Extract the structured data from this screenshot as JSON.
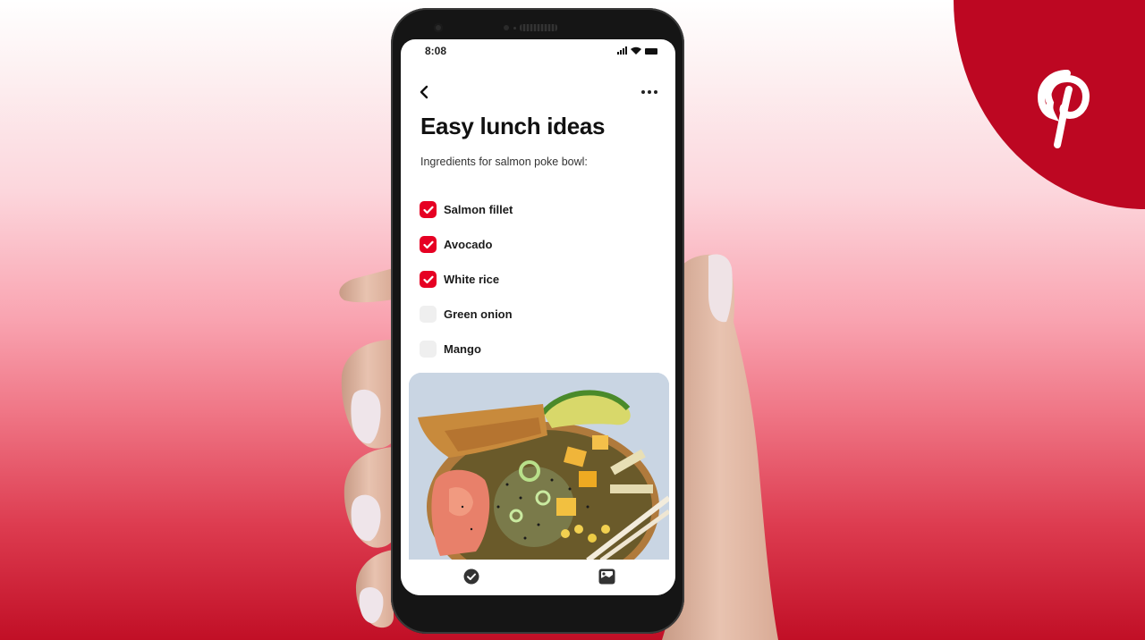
{
  "brand": {
    "name": "Pinterest",
    "logo_icon": "pinterest-p-logo",
    "color": "#bd0722"
  },
  "status_bar": {
    "time": "8:08",
    "icons": [
      "signal-icon",
      "wifi-icon",
      "battery-icon"
    ]
  },
  "nav": {
    "back_icon": "chevron-left-icon",
    "more_icon": "more-horizontal-icon"
  },
  "board": {
    "title": "Easy lunch ideas",
    "subtitle": "Ingredients for salmon poke bowl:",
    "accent_color": "#e60023",
    "checklist": [
      {
        "label": "Salmon fillet",
        "checked": true
      },
      {
        "label": "Avocado",
        "checked": true
      },
      {
        "label": "White rice",
        "checked": true
      },
      {
        "label": "Green onion",
        "checked": false
      },
      {
        "label": "Mango",
        "checked": false
      }
    ],
    "image": {
      "alt": "Salmon poke bowl with avocado, mango, green onion and chopsticks"
    }
  },
  "bottom_tabs": [
    {
      "name": "checklist",
      "icon": "check-circle-icon"
    },
    {
      "name": "image",
      "icon": "image-icon"
    }
  ]
}
